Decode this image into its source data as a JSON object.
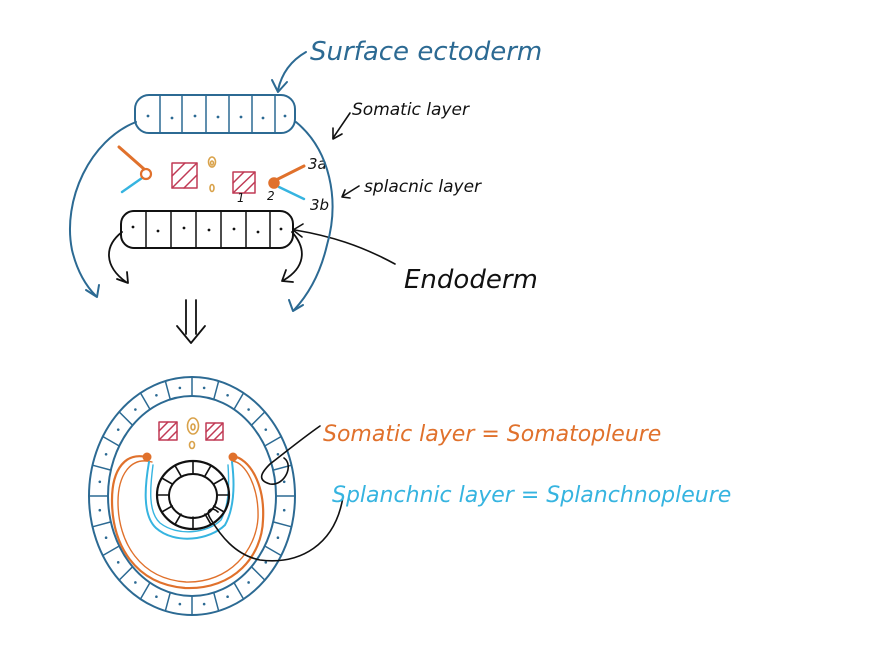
{
  "labels": {
    "surface_ectoderm": "Surface ectoderm",
    "somatic_layer_top": "Somatic layer",
    "label_3a": "3a",
    "splanchnic_layer_top": "splacnic layer",
    "label_3b": "3b",
    "label_1": "1",
    "label_2": "2",
    "endoderm": "Endoderm",
    "somatic_eq": "Somatic layer = Somatopleure",
    "splanchnic_eq": "Splanchnic layer = Splanchnopleure"
  },
  "colors": {
    "blue_ink": "#2c6a93",
    "black_ink": "#111111",
    "orange": "#e0712c",
    "cyan": "#36b4e0",
    "crimson": "#c03a55",
    "gold": "#d9a24a"
  }
}
